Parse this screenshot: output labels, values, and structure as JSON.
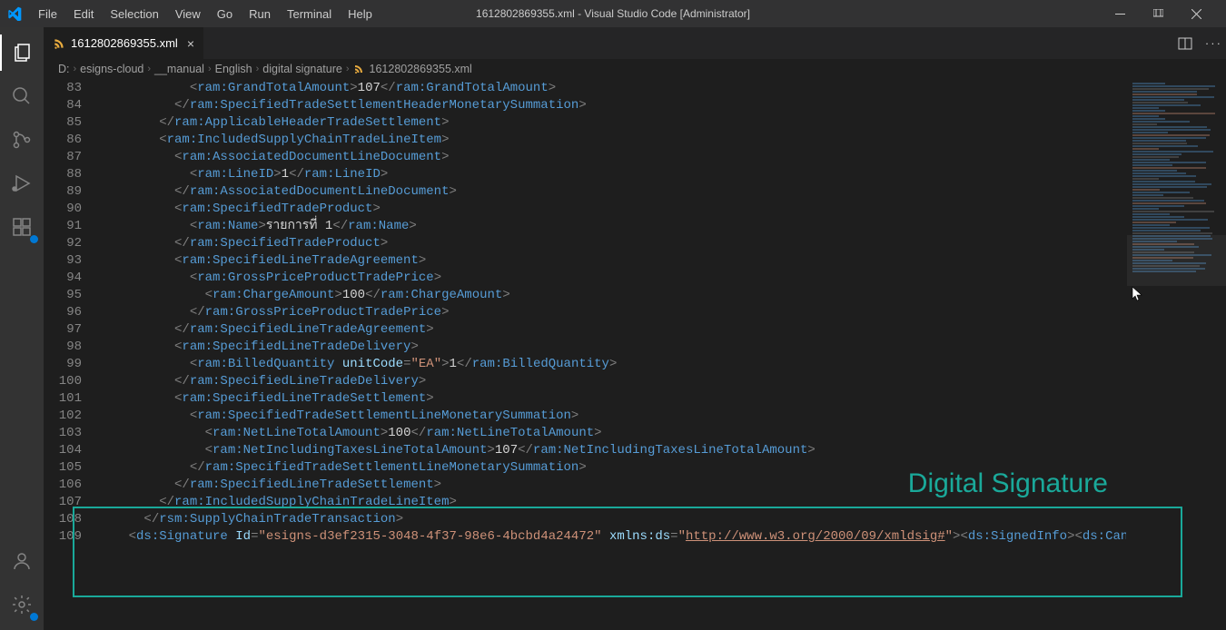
{
  "titlebar": {
    "menu": [
      "File",
      "Edit",
      "Selection",
      "View",
      "Go",
      "Run",
      "Terminal",
      "Help"
    ],
    "title": "1612802869355.xml - Visual Studio Code [Administrator]"
  },
  "tab": {
    "label": "1612802869355.xml"
  },
  "breadcrumb": [
    "D:",
    "esigns-cloud",
    "__manual",
    "English",
    "digital signature",
    "1612802869355.xml"
  ],
  "annotation": "Digital Signature",
  "lines": [
    {
      "n": 83,
      "i": 6,
      "seg": [
        [
          "p",
          "<"
        ],
        [
          "t",
          "ram:GrandTotalAmount"
        ],
        [
          "p",
          ">"
        ],
        [
          "x",
          "107"
        ],
        [
          "p",
          "</"
        ],
        [
          "t",
          "ram:GrandTotalAmount"
        ],
        [
          "p",
          ">"
        ]
      ]
    },
    {
      "n": 84,
      "i": 5,
      "seg": [
        [
          "p",
          "</"
        ],
        [
          "t",
          "ram:SpecifiedTradeSettlementHeaderMonetarySummation"
        ],
        [
          "p",
          ">"
        ]
      ]
    },
    {
      "n": 85,
      "i": 4,
      "seg": [
        [
          "p",
          "</"
        ],
        [
          "t",
          "ram:ApplicableHeaderTradeSettlement"
        ],
        [
          "p",
          ">"
        ]
      ]
    },
    {
      "n": 86,
      "i": 4,
      "seg": [
        [
          "p",
          "<"
        ],
        [
          "t",
          "ram:IncludedSupplyChainTradeLineItem"
        ],
        [
          "p",
          ">"
        ]
      ]
    },
    {
      "n": 87,
      "i": 5,
      "seg": [
        [
          "p",
          "<"
        ],
        [
          "t",
          "ram:AssociatedDocumentLineDocument"
        ],
        [
          "p",
          ">"
        ]
      ]
    },
    {
      "n": 88,
      "i": 6,
      "seg": [
        [
          "p",
          "<"
        ],
        [
          "t",
          "ram:LineID"
        ],
        [
          "p",
          ">"
        ],
        [
          "x",
          "1"
        ],
        [
          "p",
          "</"
        ],
        [
          "t",
          "ram:LineID"
        ],
        [
          "p",
          ">"
        ]
      ]
    },
    {
      "n": 89,
      "i": 5,
      "seg": [
        [
          "p",
          "</"
        ],
        [
          "t",
          "ram:AssociatedDocumentLineDocument"
        ],
        [
          "p",
          ">"
        ]
      ]
    },
    {
      "n": 90,
      "i": 5,
      "seg": [
        [
          "p",
          "<"
        ],
        [
          "t",
          "ram:SpecifiedTradeProduct"
        ],
        [
          "p",
          ">"
        ]
      ]
    },
    {
      "n": 91,
      "i": 6,
      "seg": [
        [
          "p",
          "<"
        ],
        [
          "t",
          "ram:Name"
        ],
        [
          "p",
          ">"
        ],
        [
          "x",
          "รายการที่ 1"
        ],
        [
          "p",
          "</"
        ],
        [
          "t",
          "ram:Name"
        ],
        [
          "p",
          ">"
        ]
      ]
    },
    {
      "n": 92,
      "i": 5,
      "seg": [
        [
          "p",
          "</"
        ],
        [
          "t",
          "ram:SpecifiedTradeProduct"
        ],
        [
          "p",
          ">"
        ]
      ]
    },
    {
      "n": 93,
      "i": 5,
      "seg": [
        [
          "p",
          "<"
        ],
        [
          "t",
          "ram:SpecifiedLineTradeAgreement"
        ],
        [
          "p",
          ">"
        ]
      ]
    },
    {
      "n": 94,
      "i": 6,
      "seg": [
        [
          "p",
          "<"
        ],
        [
          "t",
          "ram:GrossPriceProductTradePrice"
        ],
        [
          "p",
          ">"
        ]
      ]
    },
    {
      "n": 95,
      "i": 7,
      "seg": [
        [
          "p",
          "<"
        ],
        [
          "t",
          "ram:ChargeAmount"
        ],
        [
          "p",
          ">"
        ],
        [
          "x",
          "100"
        ],
        [
          "p",
          "</"
        ],
        [
          "t",
          "ram:ChargeAmount"
        ],
        [
          "p",
          ">"
        ]
      ]
    },
    {
      "n": 96,
      "i": 6,
      "seg": [
        [
          "p",
          "</"
        ],
        [
          "t",
          "ram:GrossPriceProductTradePrice"
        ],
        [
          "p",
          ">"
        ]
      ]
    },
    {
      "n": 97,
      "i": 5,
      "seg": [
        [
          "p",
          "</"
        ],
        [
          "t",
          "ram:SpecifiedLineTradeAgreement"
        ],
        [
          "p",
          ">"
        ]
      ]
    },
    {
      "n": 98,
      "i": 5,
      "seg": [
        [
          "p",
          "<"
        ],
        [
          "t",
          "ram:SpecifiedLineTradeDelivery"
        ],
        [
          "p",
          ">"
        ]
      ]
    },
    {
      "n": 99,
      "i": 6,
      "seg": [
        [
          "p",
          "<"
        ],
        [
          "t",
          "ram:BilledQuantity"
        ],
        [
          "p",
          " "
        ],
        [
          "a",
          "unitCode"
        ],
        [
          "p",
          "="
        ],
        [
          "s",
          "\"EA\""
        ],
        [
          "p",
          ">"
        ],
        [
          "x",
          "1"
        ],
        [
          "p",
          "</"
        ],
        [
          "t",
          "ram:BilledQuantity"
        ],
        [
          "p",
          ">"
        ]
      ]
    },
    {
      "n": 100,
      "i": 5,
      "seg": [
        [
          "p",
          "</"
        ],
        [
          "t",
          "ram:SpecifiedLineTradeDelivery"
        ],
        [
          "p",
          ">"
        ]
      ]
    },
    {
      "n": 101,
      "i": 5,
      "seg": [
        [
          "p",
          "<"
        ],
        [
          "t",
          "ram:SpecifiedLineTradeSettlement"
        ],
        [
          "p",
          ">"
        ]
      ]
    },
    {
      "n": 102,
      "i": 6,
      "seg": [
        [
          "p",
          "<"
        ],
        [
          "t",
          "ram:SpecifiedTradeSettlementLineMonetarySummation"
        ],
        [
          "p",
          ">"
        ]
      ]
    },
    {
      "n": 103,
      "i": 7,
      "seg": [
        [
          "p",
          "<"
        ],
        [
          "t",
          "ram:NetLineTotalAmount"
        ],
        [
          "p",
          ">"
        ],
        [
          "x",
          "100"
        ],
        [
          "p",
          "</"
        ],
        [
          "t",
          "ram:NetLineTotalAmount"
        ],
        [
          "p",
          ">"
        ]
      ]
    },
    {
      "n": 104,
      "i": 7,
      "seg": [
        [
          "p",
          "<"
        ],
        [
          "t",
          "ram:NetIncludingTaxesLineTotalAmount"
        ],
        [
          "p",
          ">"
        ],
        [
          "x",
          "107"
        ],
        [
          "p",
          "</"
        ],
        [
          "t",
          "ram:NetIncludingTaxesLineTotalAmount"
        ],
        [
          "p",
          ">"
        ]
      ]
    },
    {
      "n": 105,
      "i": 6,
      "seg": [
        [
          "p",
          "</"
        ],
        [
          "t",
          "ram:SpecifiedTradeSettlementLineMonetarySummation"
        ],
        [
          "p",
          ">"
        ]
      ]
    },
    {
      "n": 106,
      "i": 5,
      "seg": [
        [
          "p",
          "</"
        ],
        [
          "t",
          "ram:SpecifiedLineTradeSettlement"
        ],
        [
          "p",
          ">"
        ]
      ]
    },
    {
      "n": 107,
      "i": 4,
      "seg": [
        [
          "p",
          "</"
        ],
        [
          "t",
          "ram:IncludedSupplyChainTradeLineItem"
        ],
        [
          "p",
          ">"
        ]
      ]
    },
    {
      "n": 108,
      "i": 3,
      "seg": [
        [
          "p",
          "</"
        ],
        [
          "t",
          "rsm:SupplyChainTradeTransaction"
        ],
        [
          "p",
          ">"
        ]
      ]
    },
    {
      "n": 109,
      "i": 2,
      "seg": [
        [
          "p",
          "<"
        ],
        [
          "t",
          "ds:Signature"
        ],
        [
          "p",
          " "
        ],
        [
          "a",
          "Id"
        ],
        [
          "p",
          "="
        ],
        [
          "s",
          "\"esigns-d3ef2315-3048-4f37-98e6-4bcbd4a24472\""
        ],
        [
          "p",
          " "
        ],
        [
          "a",
          "xmlns:ds"
        ],
        [
          "p",
          "="
        ],
        [
          "s",
          "\""
        ],
        [
          "l",
          "http://www.w3.org/2000/09/xmldsig#"
        ],
        [
          "s",
          "\""
        ],
        [
          "p",
          ">"
        ],
        [
          "p",
          "<"
        ],
        [
          "t",
          "ds:SignedInfo"
        ],
        [
          "p",
          ">"
        ],
        [
          "p",
          "<"
        ],
        [
          "t",
          "ds:CanonicalizationM"
        ]
      ]
    }
  ]
}
